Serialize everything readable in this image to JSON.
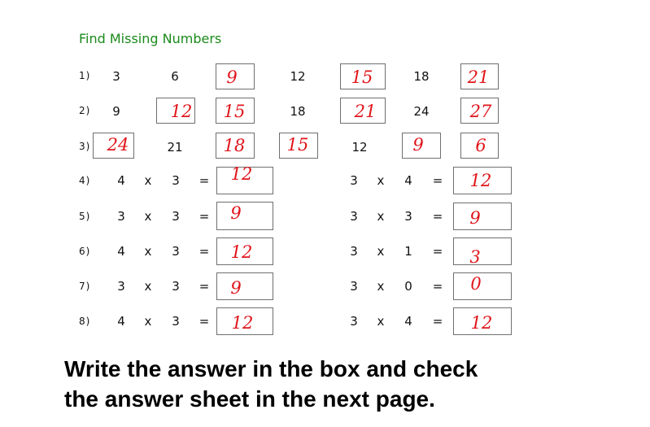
{
  "title": "Find Missing Numbers",
  "labels": [
    "1)",
    "2)",
    "3)",
    "4)",
    "5)",
    "6)",
    "7)",
    "8)"
  ],
  "sequences": [
    [
      "3",
      "6",
      "9",
      "12",
      "15",
      "18",
      "21"
    ],
    [
      "9",
      "12",
      "15",
      "18",
      "21",
      "24",
      "27"
    ],
    [
      "24",
      "21",
      "18",
      "15",
      "12",
      "9",
      "6"
    ]
  ],
  "multiplication": {
    "times_symbol": "x",
    "equals_symbol": "=",
    "left": [
      {
        "a": "4",
        "b": "3",
        "answer": "12"
      },
      {
        "a": "3",
        "b": "3",
        "answer": "9"
      },
      {
        "a": "4",
        "b": "3",
        "answer": "12"
      },
      {
        "a": "3",
        "b": "3",
        "answer": "9"
      },
      {
        "a": "4",
        "b": "3",
        "answer": "12"
      }
    ],
    "right": [
      {
        "a": "3",
        "b": "4",
        "answer": "12"
      },
      {
        "a": "3",
        "b": "3",
        "answer": "9"
      },
      {
        "a": "3",
        "b": "1",
        "answer": "3"
      },
      {
        "a": "3",
        "b": "0",
        "answer": "0"
      },
      {
        "a": "3",
        "b": "4",
        "answer": "12"
      }
    ]
  },
  "instruction": {
    "line1": "Write the answer in the box and check",
    "line2": "the answer sheet in the next page."
  }
}
